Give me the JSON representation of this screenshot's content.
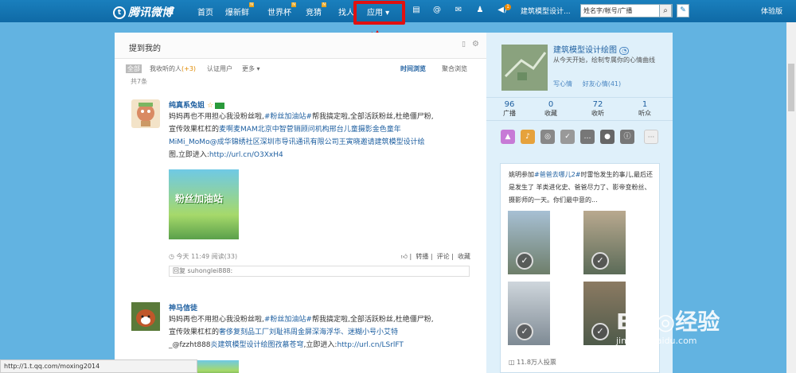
{
  "topbar": {
    "logo_text": "腾讯微博",
    "nav": [
      "首页",
      "爆新鲜",
      "世界杯",
      "竞猜",
      "找人",
      "应用"
    ],
    "nav_badge": "N",
    "apps_label": "应用 ▾",
    "user_label": "建筑模型设计...",
    "search_placeholder": "姓名字/帐号/广播",
    "notify_count": "1",
    "trial": "体验版"
  },
  "main": {
    "title": "提到我的",
    "tabs": [
      "全部",
      "我收听的人",
      "(+3)",
      "认证用户",
      "更多 ▾"
    ],
    "view_tabs": [
      "时间浏览",
      "聚合浏览"
    ],
    "count": "共7条",
    "posts": [
      {
        "name": "纯真系兔姐",
        "text1": "妈妈再也不用担心我没粉丝啦,",
        "text1_link": "#粉丝加油站#",
        "text1b": "帮我搞定啦,全部活跃粉丝,杜绝僵尸粉,",
        "text2": "宣传效果杠杠的",
        "text2_link": "麦啊麦MAM北京中智菅销顾问机构邢台儿童摄影金色童年",
        "text3_link": "MiMi_MoMo@成华锦绣社区深圳市导讯通讯有限公司王寅晓邀请建筑模型设计绘",
        "text4": "图,立即进入:",
        "text4_link": "http://url.cn/O3XxH4",
        "image_text": "粉丝加油站",
        "time": "今天 11:49 阅读(33)",
        "actions": [
          "转播",
          "评论",
          "收藏"
        ],
        "reply": "回复 suhonglei888:"
      },
      {
        "name": "神马信徒",
        "text1": "妈妈再也不用担心我没粉丝啦,",
        "text1_link": "#粉丝加油站#",
        "text1b": "帮我搞定啦,全部活跃粉丝,杜绝僵尸粉,",
        "text2": "宣传效果杠杠的",
        "text2_link": "奢侈复刻品工厂刘耻祎周金屏深海浮华、迷糊小号小艾特",
        "text3": "_@fzzht888",
        "text3_link": "炎建筑模型设计绘图孜慕苍穹",
        "text3b": ",立即进入:",
        "text3_url": "http://url.cn/LSrlFT"
      }
    ]
  },
  "sidebar": {
    "name": "建筑模型设计绘图",
    "desc": "从今天开始，绘制专属你的心情曲线",
    "links": [
      "写心情",
      "好友心情(41)"
    ],
    "stats": [
      {
        "n": "96",
        "l": "广播"
      },
      {
        "n": "0",
        "l": "收藏"
      },
      {
        "n": "72",
        "l": "收听"
      },
      {
        "n": "1",
        "l": "听众"
      }
    ],
    "card_text1": "姚明参加",
    "card_link1": "#爸爸去哪儿2#",
    "card_text2": "时雷怡发生的事儿,最后还是发生了 羊类进化史、爸爸尽力了、影帝变粉丝、摄影师的一天。你们最中意的...",
    "votes": "11.8万人投票"
  },
  "statusbar": "http://1.t.qq.com/moxing2014",
  "watermark": {
    "main": "Bai◎经验",
    "sub": "jingyan.baidu.com"
  }
}
